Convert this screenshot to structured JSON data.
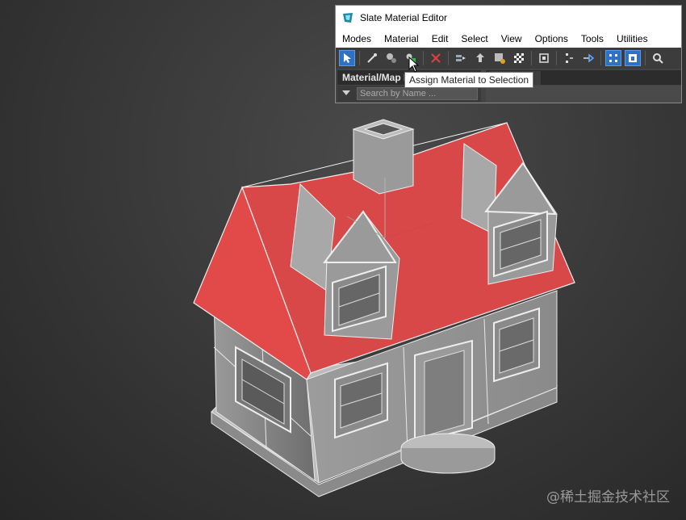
{
  "window": {
    "title": "Slate Material Editor"
  },
  "menu": [
    "Modes",
    "Material",
    "Edit",
    "Select",
    "View",
    "Options",
    "Tools",
    "Utilities"
  ],
  "toolbar": {
    "icons": [
      "select-icon",
      "eyedropper-icon",
      "put-to-scene-icon",
      "assign-material-icon",
      "delete-icon",
      "move-children-icon",
      "select-by-material-icon",
      "show-map-icon",
      "background-icon",
      "layout-icon",
      "nav-icon",
      "layout-all-icon",
      "show-end-result-icon",
      "options-icon"
    ]
  },
  "material_map_browser": {
    "title": "Material/Map Browser",
    "search_placeholder": "Search by Name ..."
  },
  "tooltip": {
    "text": "Assign Material to Selection"
  },
  "watermark": {
    "text": "@稀土掘金技术社区"
  },
  "colors": {
    "roof": "#d94848",
    "toolbar_active": "#2f72c4",
    "viewport_bg": "#3a3a3a"
  }
}
